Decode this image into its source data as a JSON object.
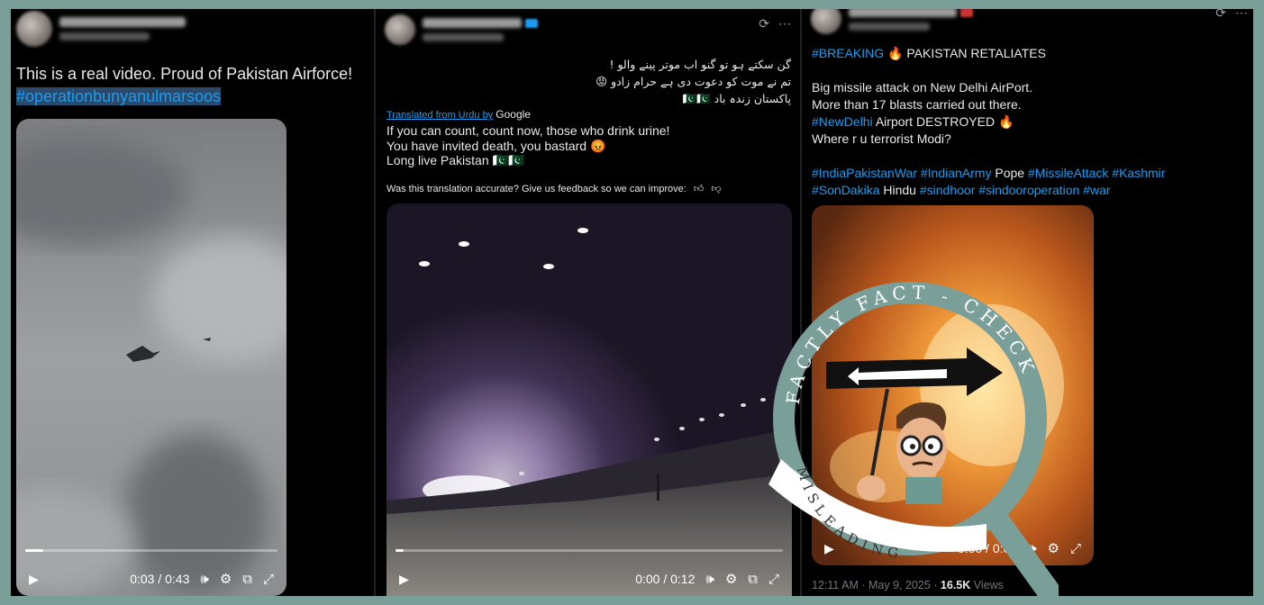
{
  "panel1": {
    "tweet_text": "This is a real video. Proud of Pakistan Airforce!",
    "hashtag": "#operationbunyanulmarsoos",
    "video_time": "0:03 / 0:43",
    "video_progress": 0.07
  },
  "panel2": {
    "urdu_line1": "گن سکتے ہو تو گنو اب موتر پینے والو !",
    "urdu_line2": "تم نے موت کو دعوت دی ہے حرام زادو 😡",
    "urdu_line3": "پاکستان زندہ باد 🇵🇰🇵🇰",
    "translated_label": "Translated from Urdu by",
    "google_label": "Google",
    "translation_line1": "If you can count, count now, those who drink urine!",
    "translation_line2": "You have invited death, you bastard 😡",
    "translation_line3": "Long live Pakistan 🇵🇰🇵🇰",
    "feedback_text": "Was this translation accurate? Give us feedback so we can improve:",
    "video_time": "0:00 / 0:12",
    "video_progress": 0.02
  },
  "panel3": {
    "breaking": "#BREAKING",
    "breaking_rest": "PAKISTAN RETALIATES",
    "line1": "Big missile attack on New Delhi AirPort.",
    "line2": "More than 17 blasts carried out there.",
    "line3_tag": "#NewDelhi",
    "line3_rest": "Airport DESTROYED",
    "line4": "Where r u terrorist Modi?",
    "tags_row1_a": "#IndiaPakistanWar #IndianArmy",
    "tags_row1_b": "Pope",
    "tags_row1_c": "#MissileAttack #Kashmir",
    "tags_row2_a": "#SonDakika",
    "tags_row2_b": "Hindu",
    "tags_row2_c": "#sindhoor #sindooroperation #war",
    "video_time": "0:00 / 0:08",
    "timestamp": "12:11 AM · May 9, 2025 ·",
    "views_count": "16.5K",
    "views_label": "Views"
  },
  "watermark": {
    "top_text": "FACTLY FACT - CHECK",
    "ribbon_text": "MISLEADING",
    "ring_color": "#7a9e98"
  },
  "icons": {
    "play": "play-icon",
    "volume": "volume-icon",
    "settings": "settings-icon",
    "pip": "picture-in-picture-icon",
    "fullscreen": "fullscreen-icon",
    "more": "more-icon",
    "grok": "grok-icon",
    "like": "thumbs-up-icon",
    "dislike": "thumbs-down-icon"
  }
}
